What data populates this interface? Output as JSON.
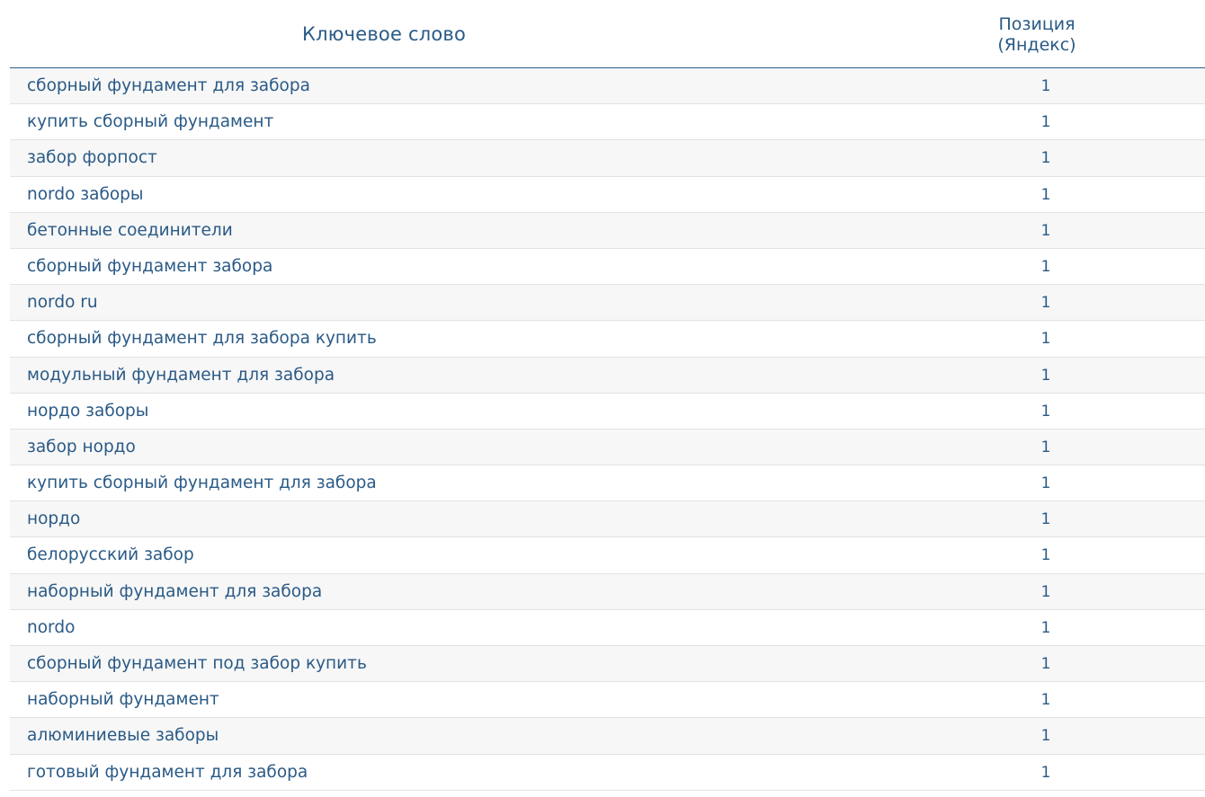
{
  "table": {
    "headers": {
      "keyword": "Ключевое слово",
      "position_line1": "Позиция",
      "position_line2": "(Яндекс)"
    },
    "rows": [
      {
        "keyword": "сборный фундамент для забора",
        "position": "1"
      },
      {
        "keyword": "купить сборный фундамент",
        "position": "1"
      },
      {
        "keyword": "забор форпост",
        "position": "1"
      },
      {
        "keyword": "nordo заборы",
        "position": "1"
      },
      {
        "keyword": "бетонные соединители",
        "position": "1"
      },
      {
        "keyword": "сборный фундамент забора",
        "position": "1"
      },
      {
        "keyword": "nordo ru",
        "position": "1"
      },
      {
        "keyword": "сборный фундамент для забора купить",
        "position": "1"
      },
      {
        "keyword": "модульный фундамент для забора",
        "position": "1"
      },
      {
        "keyword": "нордо заборы",
        "position": "1"
      },
      {
        "keyword": "забор нордо",
        "position": "1"
      },
      {
        "keyword": "купить сборный фундамент для забора",
        "position": "1"
      },
      {
        "keyword": "нордо",
        "position": "1"
      },
      {
        "keyword": "белорусский забор",
        "position": "1"
      },
      {
        "keyword": "наборный фундамент для забора",
        "position": "1"
      },
      {
        "keyword": "nordo",
        "position": "1"
      },
      {
        "keyword": "сборный фундамент под забор купить",
        "position": "1"
      },
      {
        "keyword": "наборный фундамент",
        "position": "1"
      },
      {
        "keyword": "алюминиевые заборы",
        "position": "1"
      },
      {
        "keyword": "готовый фундамент для забора",
        "position": "1"
      }
    ]
  },
  "colors": {
    "text": "#2a5a86",
    "header_border": "#2f5f87",
    "row_stripe": "#f7f7f7",
    "row_border": "#e2e2e2"
  }
}
